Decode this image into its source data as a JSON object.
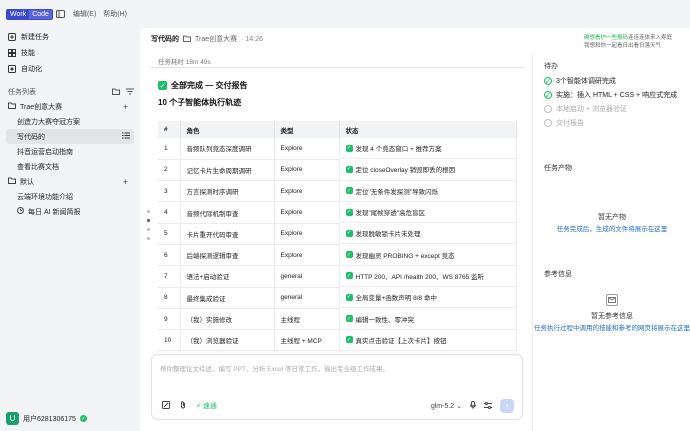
{
  "topbar": {
    "work_label": "Work",
    "code_label": "Code",
    "menu_edit": "编辑(E)",
    "menu_help": "帮助(H)"
  },
  "nav": {
    "new_task": "新建任务",
    "skills": "技能",
    "automation": "自动化"
  },
  "tasks_section": {
    "title": "任务列表"
  },
  "groups": [
    {
      "name": "Trae创意大赛",
      "items": [
        "创造力大赛夺冠方案",
        "写代码的",
        "抖音运营启动指南",
        "查看比赛文档"
      ]
    },
    {
      "name": "默认",
      "items": [
        "云端环境功能介绍",
        "每日 AI 新闻简报"
      ]
    }
  ],
  "user": {
    "name": "用户6281306175",
    "avatar_letter": "U"
  },
  "header": {
    "title": "写代码的",
    "crumb": "Trae创意大赛",
    "time": "· 14:26"
  },
  "ticker": {
    "line1_hl": "确想看护一些报码",
    "line1_rest": "连连连体来入寿庭",
    "line2": "我想和你一起看日出看日落天气"
  },
  "content": {
    "elapsed": "任务耗时 18m 49s",
    "done_title": "全部完成 — 交付报告",
    "sub_title": "10 个子智能体执行轨迹",
    "table": {
      "headers": [
        "#",
        "角色",
        "类型",
        "状态"
      ],
      "rows": [
        [
          "1",
          "音频队列竞态深度调研",
          "Explore",
          "发现 4 个竞态窗口 + 推荐方案"
        ],
        [
          "2",
          "记忆卡片生命周期调研",
          "Explore",
          "定位 closeOverlay 销毁即丢的根因"
        ],
        [
          "3",
          "方言探测时序调研",
          "Explore",
          "定位\"无条件发探测\"导致闪烁"
        ],
        [
          "4",
          "音频代际机制审查",
          "Explore",
          "发现\"尾帧穿透\"高危盲区"
        ],
        [
          "5",
          "卡片重开代码审查",
          "Explore",
          "发现脱敏锁卡片未处理"
        ],
        [
          "6",
          "后端探测逻辑审查",
          "Explore",
          "发现幽灵 PROBING + except 竞态"
        ],
        [
          "7",
          "语法+启动验证",
          "general",
          "HTTP 200、API /health 200、WS 8765 监听"
        ],
        [
          "8",
          "最终集成验证",
          "general",
          "全局变量+函数声明 8/8 命中"
        ],
        [
          "9",
          "（我）实施修改",
          "主线程",
          "编辑一致性、零冲突"
        ],
        [
          "10",
          "（我）浏览器验证",
          "主线程 + MCP",
          "真实点击验证【上次卡片】按钮"
        ]
      ]
    }
  },
  "composer": {
    "placeholder": "帮你整理论文综述、编写 PPT、分析 Excel 等日常工作，输出专业级工作成果。",
    "auto_label": "速通",
    "model": "glm-5.2"
  },
  "right_panel": {
    "todo_title": "待办",
    "todos": [
      {
        "label": "3个智能体调研完成",
        "done": true
      },
      {
        "label": "实施：插入 HTML + CSS + 响应式完成",
        "done": true
      },
      {
        "label": "本地启动 + 浏览器验证",
        "done": false
      },
      {
        "label": "交付报告",
        "done": false
      }
    ],
    "output_title": "任务产物",
    "output_empty": "暂无产物",
    "output_hint": "任务完成后，生成的文件将展示在这里",
    "ref_title": "参考信息",
    "ref_empty": "暂无参考信息",
    "ref_hint": "任务执行过程中调用的技能和参考的网页将展示在这里"
  },
  "colors": {
    "accent": "#3b4bd1",
    "success": "#1fbf6a",
    "link": "#1f6bc4"
  }
}
